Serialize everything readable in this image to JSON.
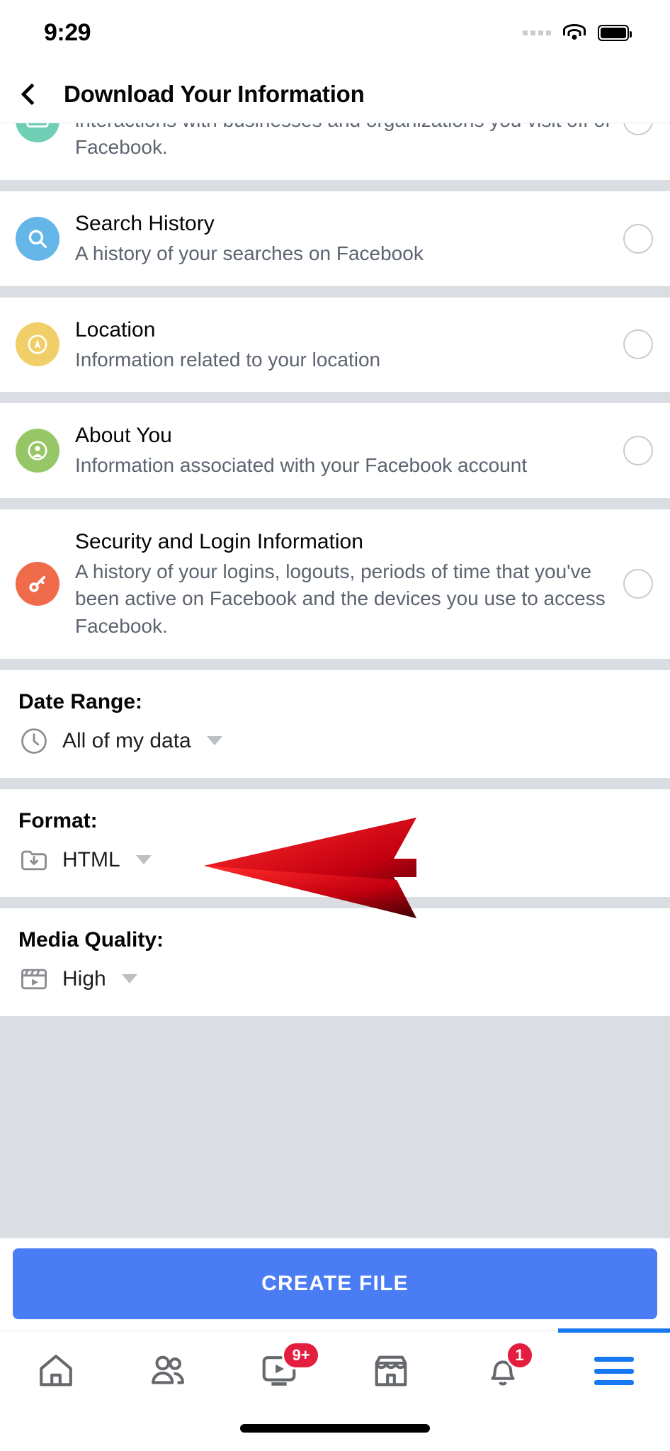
{
  "status_bar": {
    "time": "9:29",
    "signal_icon": "signal-dots-icon",
    "wifi_icon": "wifi-icon",
    "battery_icon": "battery-full-icon"
  },
  "header": {
    "back_icon": "back-chevron-icon",
    "title": "Download Your Information"
  },
  "data_categories": [
    {
      "id": "ads-and-businesses",
      "title": "",
      "description": "you, information you've submitted to advertisers and your interactions with businesses and organizations you visit off of Facebook.",
      "icon": "ads-tag-icon",
      "icon_color": "#6fcfb4",
      "selected": false,
      "partial": true
    },
    {
      "id": "search-history",
      "title": "Search History",
      "description": "A history of your searches on Facebook",
      "icon": "search-icon",
      "icon_color": "#64b5e8",
      "selected": false,
      "partial": false
    },
    {
      "id": "location",
      "title": "Location",
      "description": "Information related to your location",
      "icon": "compass-icon",
      "icon_color": "#f0cf68",
      "selected": false,
      "partial": false
    },
    {
      "id": "about-you",
      "title": "About You",
      "description": "Information associated with your Facebook account",
      "icon": "person-circle-icon",
      "icon_color": "#97c666",
      "selected": false,
      "partial": false
    },
    {
      "id": "security-and-login",
      "title": "Security and Login Information",
      "description": "A history of your logins, logouts, periods of time that you've been active on Facebook and the devices you use to access Facebook.",
      "icon": "key-icon",
      "icon_color": "#ef6b4a",
      "selected": false,
      "partial": false
    }
  ],
  "options": {
    "date_range": {
      "label": "Date Range:",
      "value": "All of my data",
      "icon": "clock-icon",
      "highlighted": true
    },
    "format": {
      "label": "Format:",
      "value": "HTML",
      "icon": "folder-download-icon",
      "highlighted": false
    },
    "media_quality": {
      "label": "Media Quality:",
      "value": "High",
      "icon": "clapperboard-icon",
      "highlighted": false
    }
  },
  "annotation": {
    "arrow_icon": "red-arrow-left-icon",
    "arrow_color": "#e8101b"
  },
  "cta": {
    "label": "CREATE FILE",
    "color": "#4a7cf3"
  },
  "tabbar": [
    {
      "id": "home",
      "icon": "home-icon",
      "badge": "",
      "active": false
    },
    {
      "id": "friends",
      "icon": "friends-icon",
      "badge": "",
      "active": false
    },
    {
      "id": "watch",
      "icon": "watch-video-icon",
      "badge": "9+",
      "active": false
    },
    {
      "id": "marketplace",
      "icon": "marketplace-shop-icon",
      "badge": "",
      "active": false
    },
    {
      "id": "notifications",
      "icon": "bell-icon",
      "badge": "1",
      "active": false
    },
    {
      "id": "menu",
      "icon": "hamburger-menu-icon",
      "badge": "",
      "active": true
    }
  ]
}
